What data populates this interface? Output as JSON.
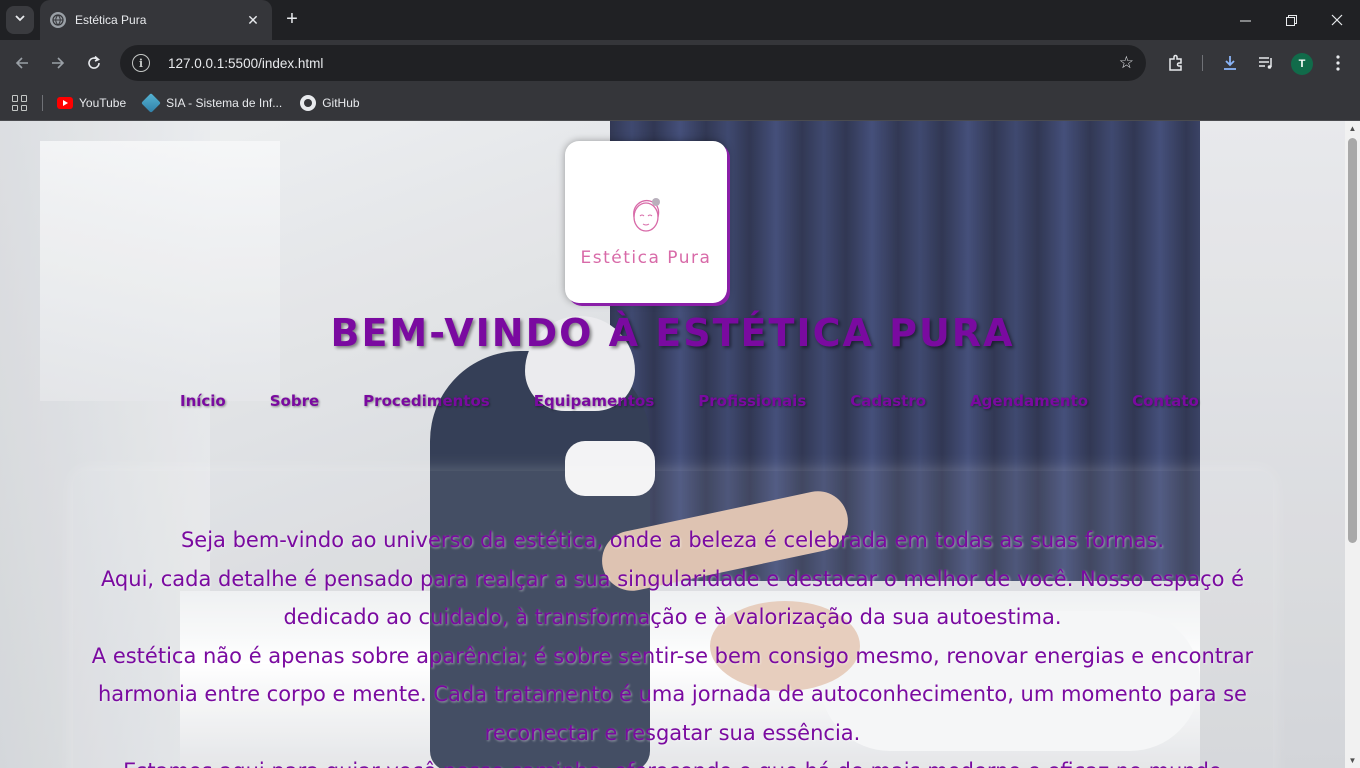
{
  "browser": {
    "tab_title": "Estética Pura",
    "url": "127.0.0.1:5500/index.html",
    "profile_initial": "T",
    "bookmarks": [
      {
        "label": "YouTube",
        "icon": "youtube-icon"
      },
      {
        "label": "SIA - Sistema de Inf...",
        "icon": "sia-icon"
      },
      {
        "label": "GitHub",
        "icon": "github-icon"
      }
    ]
  },
  "page": {
    "logo_text": "Estética  Pura",
    "headline": "BEM-VINDO À ESTÉTICA PURA",
    "nav": [
      "Início",
      "Sobre",
      "Procedimentos",
      "Equipamentos",
      "Profissionais",
      "Cadastro",
      "Agendamento",
      "Contato"
    ],
    "paragraphs": [
      "Seja bem-vindo ao universo da estética, onde a beleza é celebrada em todas as suas formas.",
      "Aqui, cada detalhe é pensado para realçar a sua singularidade e destacar o melhor de você. Nosso espaço é dedicado ao cuidado, à transformação e à valorização da sua autoestima.",
      "A estética não é apenas sobre aparência; é sobre sentir-se bem consigo mesmo, renovar energias e encontrar harmonia entre corpo e mente. Cada tratamento é uma jornada de autoconhecimento, um momento para se reconectar e resgatar sua essência.",
      "Estamos aqui para guiar você nesse caminho, oferecendo o que há de mais moderno e eficaz no mundo"
    ]
  },
  "colors": {
    "brand_purple": "#7a0aa0",
    "logo_pink": "#d86aa8",
    "chrome_dark": "#202124",
    "chrome_mid": "#35363a"
  }
}
